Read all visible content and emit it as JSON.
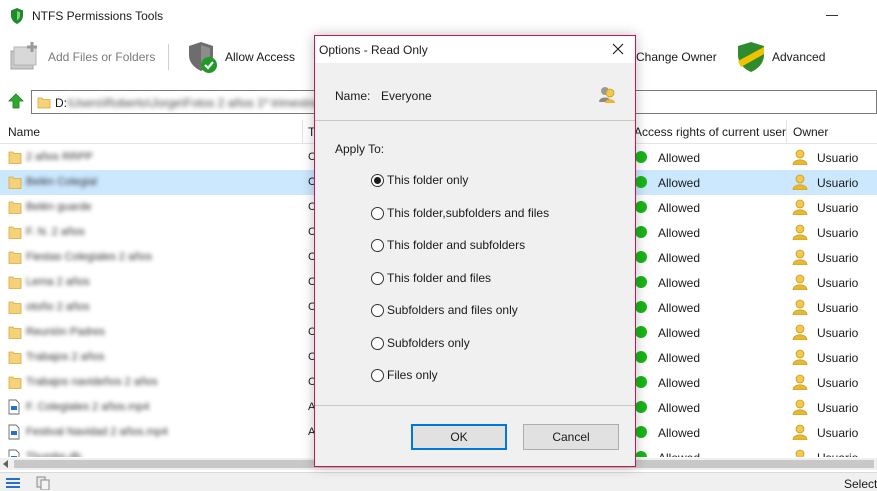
{
  "window": {
    "title": "NTFS Permissions Tools"
  },
  "toolbar": {
    "add_label": "Add Files or Folders",
    "allow_label": "Allow Access",
    "change_owner_label": "Change Owner",
    "advanced_label": "Advanced"
  },
  "path": {
    "drive": "D:",
    "rest": "\\Users\\Roberto\\Jorge\\Fotos 2 años 1º trimestre"
  },
  "columns": {
    "name": "Name",
    "type": "T",
    "access": "Access rights of current user",
    "owner": "Owner"
  },
  "files": [
    {
      "name": "2 años RRPP",
      "type": "C",
      "access": "Allowed",
      "owner": "Usuario",
      "kind": "folder",
      "selected": false
    },
    {
      "name": "Belén Colegial",
      "type": "C",
      "access": "Allowed",
      "owner": "Usuario",
      "kind": "folder",
      "selected": true
    },
    {
      "name": "Belén guarde",
      "type": "C",
      "access": "Allowed",
      "owner": "Usuario",
      "kind": "folder",
      "selected": false
    },
    {
      "name": "F. N. 2 años",
      "type": "C",
      "access": "Allowed",
      "owner": "Usuario",
      "kind": "folder",
      "selected": false
    },
    {
      "name": "Fiestas Colegiales 2 años",
      "type": "C",
      "access": "Allowed",
      "owner": "Usuario",
      "kind": "folder",
      "selected": false
    },
    {
      "name": "Lema 2 años",
      "type": "C",
      "access": "Allowed",
      "owner": "Usuario",
      "kind": "folder",
      "selected": false
    },
    {
      "name": "otoño 2 años",
      "type": "C",
      "access": "Allowed",
      "owner": "Usuario",
      "kind": "folder",
      "selected": false
    },
    {
      "name": "Reunión Padres",
      "type": "C",
      "access": "Allowed",
      "owner": "Usuario",
      "kind": "folder",
      "selected": false
    },
    {
      "name": "Trabajos 2 años",
      "type": "C",
      "access": "Allowed",
      "owner": "Usuario",
      "kind": "folder",
      "selected": false
    },
    {
      "name": "Trabajos navideños 2 años",
      "type": "C",
      "access": "Allowed",
      "owner": "Usuario",
      "kind": "folder",
      "selected": false
    },
    {
      "name": "F. Colegiales 2 años.mp4",
      "type": "A",
      "access": "Allowed",
      "owner": "Usuario",
      "kind": "file",
      "selected": false
    },
    {
      "name": "Festival Navidad 2 años.mp4",
      "type": "A",
      "access": "Allowed",
      "owner": "Usuario",
      "kind": "file",
      "selected": false
    },
    {
      "name": "Thumbs.db",
      "type": "",
      "access": "Allowed",
      "owner": "Usuario",
      "kind": "file",
      "selected": false
    }
  ],
  "statusbar": {
    "text": "Selecte"
  },
  "dialog": {
    "title": "Options - Read Only",
    "name_label": "Name:",
    "name_value": "Everyone",
    "apply_label": "Apply To:",
    "options": [
      {
        "label": "This folder only",
        "checked": true
      },
      {
        "label": "This folder,subfolders and files",
        "checked": false
      },
      {
        "label": "This folder and subfolders",
        "checked": false
      },
      {
        "label": "This folder and files",
        "checked": false
      },
      {
        "label": "Subfolders and files only",
        "checked": false
      },
      {
        "label": "Subfolders only",
        "checked": false
      },
      {
        "label": "Files only",
        "checked": false
      }
    ],
    "ok_label": "OK",
    "cancel_label": "Cancel"
  },
  "colors": {
    "selection": "#cce8ff",
    "allowed_dot": "#18b618",
    "dialog_border": "#c2185b",
    "primary_button_border": "#0078d7"
  },
  "icons": {
    "app": "shield-icon",
    "add": "add-file-icon",
    "allow": "shield-check-icon",
    "change_owner": "owner-icon",
    "advanced": "shield-stripe-icon",
    "up": "green-up-arrow-icon",
    "folder": "folder-icon",
    "file": "file-icon",
    "user": "user-icon",
    "everyone": "user-group-icon"
  }
}
